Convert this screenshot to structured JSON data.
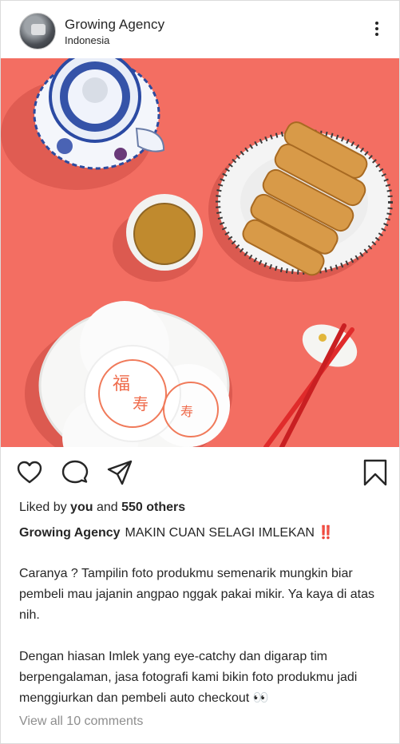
{
  "header": {
    "account_name": "Growing Agency",
    "location": "Indonesia"
  },
  "likes": {
    "prefix": "Liked by",
    "user": "you",
    "connector": "and",
    "count_text": "550 others"
  },
  "caption": {
    "author": "Growing Agency",
    "headline": "MAKIN CUAN SELAGI IMLEKAN",
    "headline_emoji": "‼️",
    "paragraph1": "Caranya ? Tampilin foto produkmu semenarik mungkin biar pembeli mau jajanin angpao nggak pakai mikir. Ya kaya di atas nih.",
    "paragraph2": "Dengan hiasan Imlek yang eye-catchy dan digarap tim berpengalaman, jasa fotografi kami bikin foto produkmu jadi menggiurkan dan pembeli auto checkout",
    "paragraph2_emoji": "👀"
  },
  "comments": {
    "link_text": "View all 10 comments"
  },
  "icons": {
    "like": "heart-icon",
    "comment": "comment-icon",
    "share": "send-icon",
    "save": "bookmark-icon",
    "more": "more-options-icon"
  },
  "colors": {
    "background_photo": "#f26f62",
    "text": "#262626",
    "muted": "#8e8e8e",
    "emoji_red": "#e0245e"
  }
}
